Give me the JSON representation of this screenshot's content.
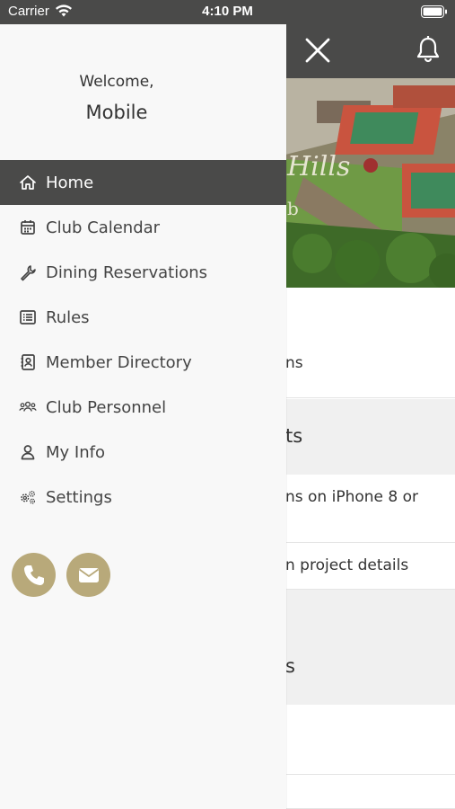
{
  "status_bar": {
    "carrier": "Carrier",
    "time": "4:10 PM",
    "icons": [
      "wifi-icon",
      "battery-icon"
    ]
  },
  "header": {
    "icons": [
      "close-icon",
      "bell-icon"
    ],
    "background": "#4a4a49"
  },
  "drawer": {
    "welcome": "Welcome,",
    "username": "Mobile",
    "items": [
      {
        "label": "Home",
        "icon": "home-icon",
        "active": true
      },
      {
        "label": "Club Calendar",
        "icon": "calendar-icon",
        "active": false
      },
      {
        "label": "Dining Reservations",
        "icon": "wrench-icon",
        "active": false
      },
      {
        "label": "Rules",
        "icon": "list-icon",
        "active": false
      },
      {
        "label": "Member Directory",
        "icon": "contact-book-icon",
        "active": false
      },
      {
        "label": "Club Personnel",
        "icon": "people-icon",
        "active": false
      },
      {
        "label": "My Info",
        "icon": "user-icon",
        "active": false
      },
      {
        "label": "Settings",
        "icon": "gears-icon",
        "active": false
      }
    ],
    "contact_icons": [
      "phone-icon",
      "email-icon"
    ]
  },
  "background_content": {
    "hero_text_fragments": [
      "Hills",
      "b"
    ],
    "fragments": [
      "ns",
      "ts",
      "ns on iPhone 8 or",
      "n project details",
      "s"
    ]
  },
  "colors": {
    "active_bg": "#4a4a49",
    "accent": "#b8a97a",
    "drawer_bg": "#f8f8f8"
  }
}
